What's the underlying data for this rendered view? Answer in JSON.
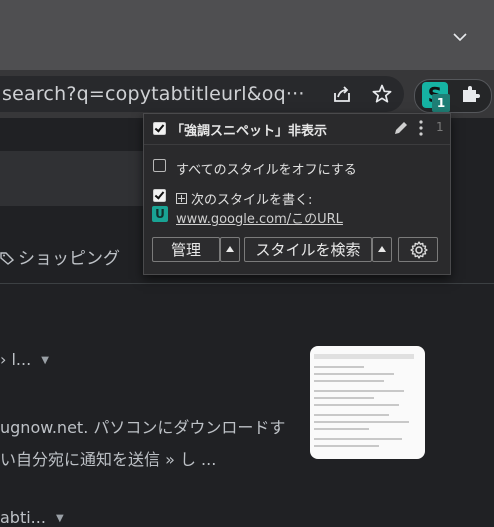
{
  "browser": {
    "url": "search?q=copytabtitleurl&oq···",
    "extension": {
      "letter": "S",
      "badge": "1",
      "color": "#16b3a3"
    }
  },
  "page": {
    "shopping_label": "ショッピング",
    "result1_fragment": "› l...",
    "desc_line1": "ugnow.net. パソコンにダウンロードす",
    "desc_line2": "い自分宛に通知を送信 » し ...",
    "result2_fragment": "abti..."
  },
  "popup": {
    "style_name": "「強調スニペット」非表示",
    "style_enabled": true,
    "style_count": "1",
    "disable_all_label": "すべてのスタイルをオフにする",
    "disable_all_checked": false,
    "write_style_label": "次のスタイルを書く:",
    "write_style_checked": true,
    "u_badge": "U",
    "target_url": "www.google.com/このURL",
    "manage_button": "管理",
    "find_styles_button": "スタイルを検索"
  },
  "icons": [
    "chevron-down-icon",
    "share-icon",
    "star-icon",
    "puzzle-icon",
    "shopping-tag-icon",
    "pencil-icon",
    "kebab-menu-icon",
    "plus-box-icon",
    "gear-icon",
    "dropdown-triangle-icon"
  ]
}
